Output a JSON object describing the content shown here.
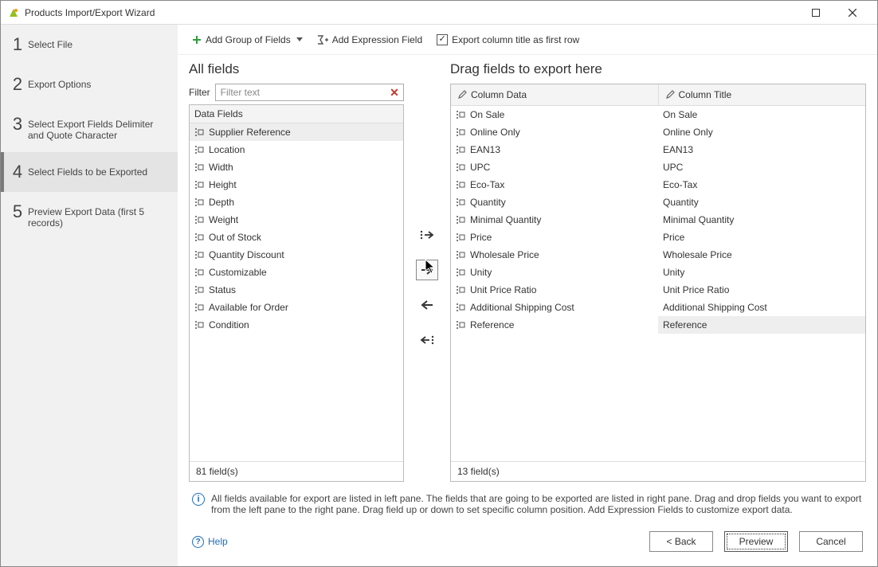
{
  "window": {
    "title": "Products Import/Export Wizard"
  },
  "sidebar": {
    "steps": [
      {
        "num": "1",
        "label": "Select File"
      },
      {
        "num": "2",
        "label": "Export Options"
      },
      {
        "num": "3",
        "label": "Select Export Fields Delimiter and Quote Character"
      },
      {
        "num": "4",
        "label": "Select Fields to be Exported"
      },
      {
        "num": "5",
        "label": "Preview Export Data (first 5 records)"
      }
    ],
    "active_index": 3
  },
  "toolbar": {
    "add_group": "Add Group of Fields",
    "add_expression": "Add Expression Field",
    "export_col_title": "Export column title as first row"
  },
  "left_pane": {
    "title": "All fields",
    "filter_label": "Filter",
    "filter_placeholder": "Filter text",
    "category": "Data Fields",
    "fields": [
      "Supplier Reference",
      "Location",
      "Width",
      "Height",
      "Depth",
      "Weight",
      "Out of Stock",
      "Quantity Discount",
      "Customizable",
      "Status",
      "Available for Order",
      "Condition"
    ],
    "selected_index": 0,
    "footer": "81 field(s)"
  },
  "right_pane": {
    "title": "Drag fields to export here",
    "col1": "Column Data",
    "col2": "Column Title",
    "rows": [
      {
        "data": "On Sale",
        "title": "On Sale"
      },
      {
        "data": "Online Only",
        "title": "Online Only"
      },
      {
        "data": "EAN13",
        "title": "EAN13"
      },
      {
        "data": "UPC",
        "title": "UPC"
      },
      {
        "data": "Eco-Tax",
        "title": "Eco-Tax"
      },
      {
        "data": "Quantity",
        "title": "Quantity"
      },
      {
        "data": "Minimal Quantity",
        "title": "Minimal Quantity"
      },
      {
        "data": "Price",
        "title": "Price"
      },
      {
        "data": "Wholesale Price",
        "title": "Wholesale Price"
      },
      {
        "data": "Unity",
        "title": "Unity"
      },
      {
        "data": "Unit Price Ratio",
        "title": "Unit Price Ratio"
      },
      {
        "data": "Additional Shipping Cost",
        "title": "Additional Shipping Cost"
      },
      {
        "data": "Reference",
        "title": "Reference"
      }
    ],
    "selected_index": 12,
    "footer": "13 field(s)"
  },
  "hint": "All fields available for export are listed in left pane. The fields that are going to be exported are listed in right pane. Drag and drop fields you want to export from the left pane to the right pane. Drag field up or down to set specific column position. Add Expression Fields to customize export data.",
  "footer": {
    "help": "Help",
    "back": "< Back",
    "preview": "Preview",
    "cancel": "Cancel"
  }
}
